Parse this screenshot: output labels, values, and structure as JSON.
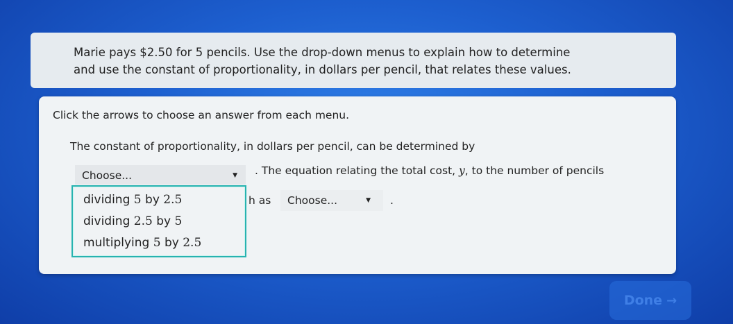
{
  "prompt": {
    "line1": "Marie pays $2.50 for 5 pencils. Use the drop-down menus to explain how to determine",
    "line2": "and use the constant of proportionality, in dollars per pencil, that relates these values."
  },
  "instruction": "Click the arrows to choose an answer from each menu.",
  "sentence1": "The constant of proportionality, in dollars per pencil, can be determined by",
  "select1": {
    "value": "Choose...",
    "arrow": "▼"
  },
  "after_select1": {
    "text_before_var": ". The equation relating the total cost, ",
    "var_y": "y",
    "text_after_var": ", to the number of pencils"
  },
  "partial_hidden": "h as",
  "select2": {
    "value": "Choose...",
    "arrow": "▼"
  },
  "period": ".",
  "dropdown_options": [
    {
      "label": "dividing",
      "a": "5",
      "mid": "by",
      "b": "2.5"
    },
    {
      "label": "dividing",
      "a": "2.5",
      "mid": "by",
      "b": "5"
    },
    {
      "label": "multiplying",
      "a": "5",
      "mid": "by",
      "b": "2.5"
    }
  ],
  "done_button": {
    "label": "Done",
    "icon": "→"
  },
  "colors": {
    "accent_teal": "#27b3b0",
    "background_blue": "#1d5fcf"
  }
}
